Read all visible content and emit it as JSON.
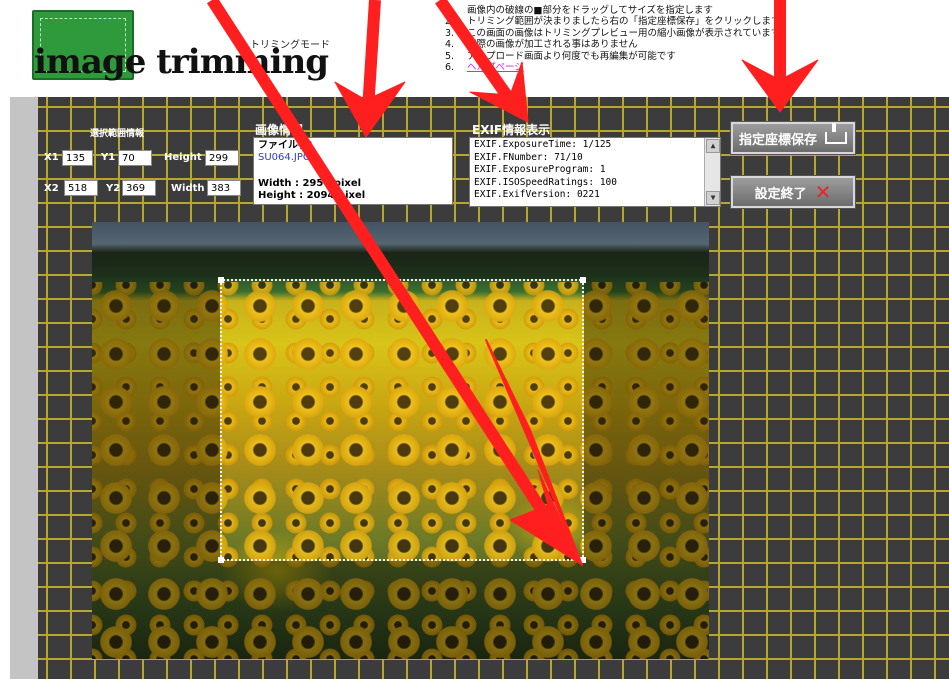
{
  "header": {
    "logo_text": "image trimming",
    "mode_label": "トリミングモード",
    "instructions": [
      {
        "num": "1.",
        "text": "画像内の破線の■部分をドラッグしてサイズを指定します"
      },
      {
        "num": "2.",
        "text": "トリミング範囲が決まりましたら右の「指定座標保存」をクリックします"
      },
      {
        "num": "3.",
        "text": "この画面の画像はトリミングプレビュー用の縮小画像が表示されています"
      },
      {
        "num": "4.",
        "text": "実際の画像が加工される事はありません"
      },
      {
        "num": "5.",
        "text": "アップロード画面より何度でも再編集が可能です"
      },
      {
        "num": "6.",
        "text": "ヘルプページ"
      }
    ]
  },
  "selection_info": {
    "title": "選択範囲情報",
    "x1_label": "X1",
    "x1": "135",
    "y1_label": "Y1",
    "y1": "70",
    "height_label": "Height",
    "height": "299",
    "x2_label": "X2",
    "x2": "518",
    "y2_label": "Y2",
    "y2": "369",
    "width_label": "Width",
    "width": "383"
  },
  "image_info": {
    "title": "画像情報",
    "file_label": "ファイル名：",
    "file_name": "SU064.JPG",
    "width_line": "Width : 2950 pixel",
    "height_line": "Height : 2094 pixel"
  },
  "exif": {
    "title": "EXIF情報表示",
    "lines": [
      "EXIF.ExposureTime: 1/125",
      "EXIF.FNumber: 71/10",
      "EXIF.ExposureProgram: 1",
      "EXIF.ISOSpeedRatings: 100",
      "EXIF.ExifVersion: 0221"
    ]
  },
  "buttons": {
    "save_label": "指定座標保存",
    "finish_label": "設定終了"
  },
  "icons": {
    "save": "tray-download-icon",
    "finish": "close-x-icon",
    "scroll_up": "▲",
    "scroll_down": "▼"
  },
  "colors": {
    "grid_line": "#b8a630",
    "grid_bg": "#3c3c3c",
    "arrow": "#ff1f1f",
    "link": "#c832c8"
  }
}
